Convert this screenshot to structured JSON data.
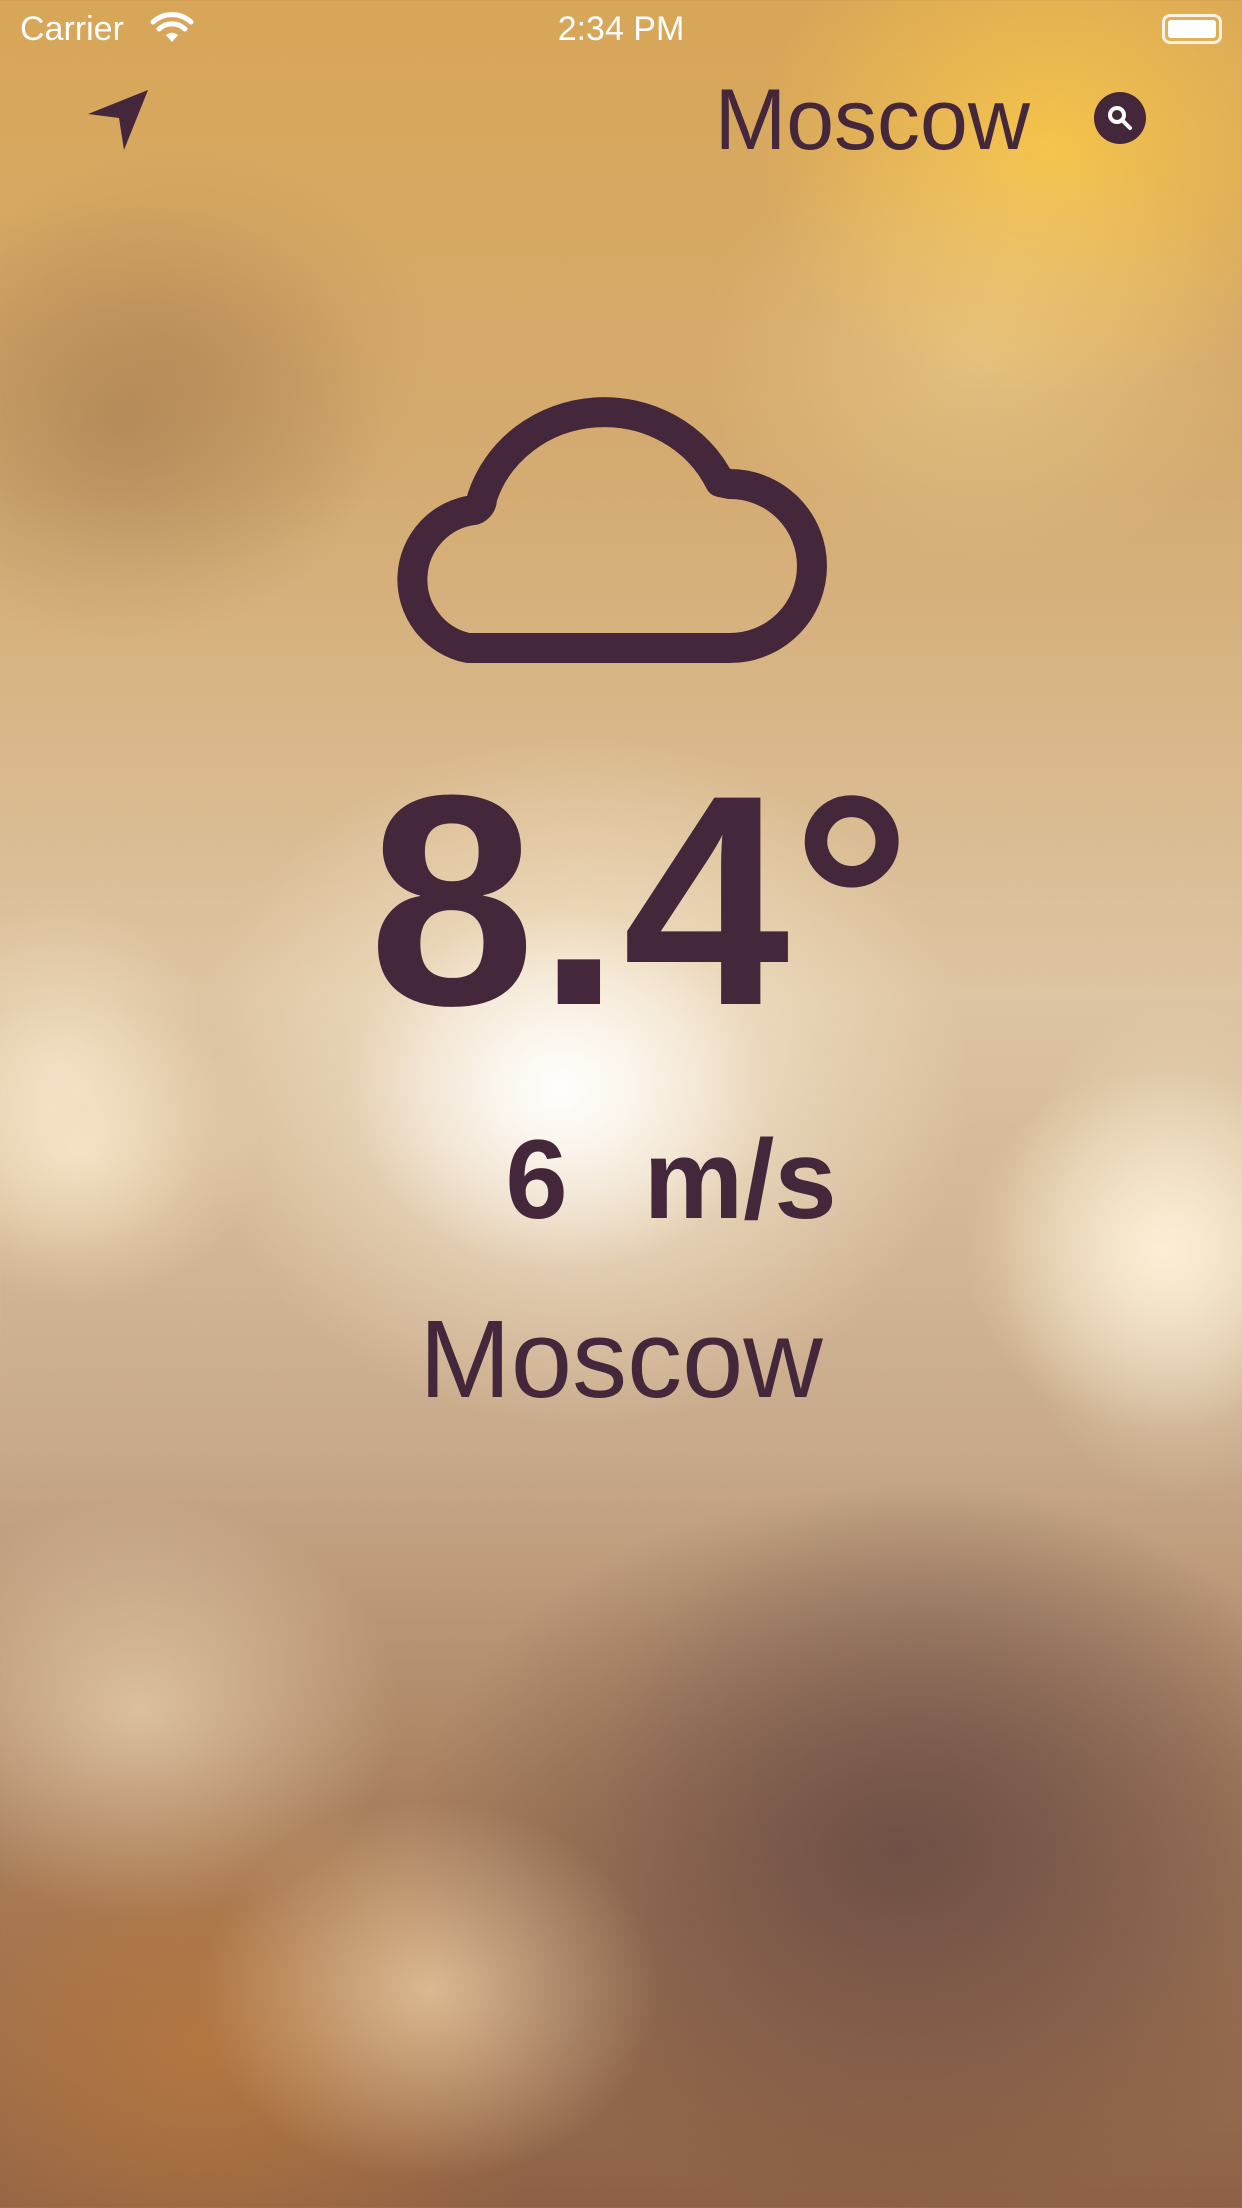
{
  "status_bar": {
    "carrier": "Carrier",
    "time": "2:34 PM"
  },
  "header": {
    "city": "Moscow",
    "location_icon": "location-arrow-icon",
    "search_icon": "magnifying-glass-icon"
  },
  "weather": {
    "condition_icon": "cloud-icon",
    "temperature": "8.4°",
    "wind_speed": "6",
    "wind_unit": "m/s",
    "city": "Moscow"
  },
  "colors": {
    "primary_text": "#44273b",
    "status_text": "#ffffff"
  }
}
